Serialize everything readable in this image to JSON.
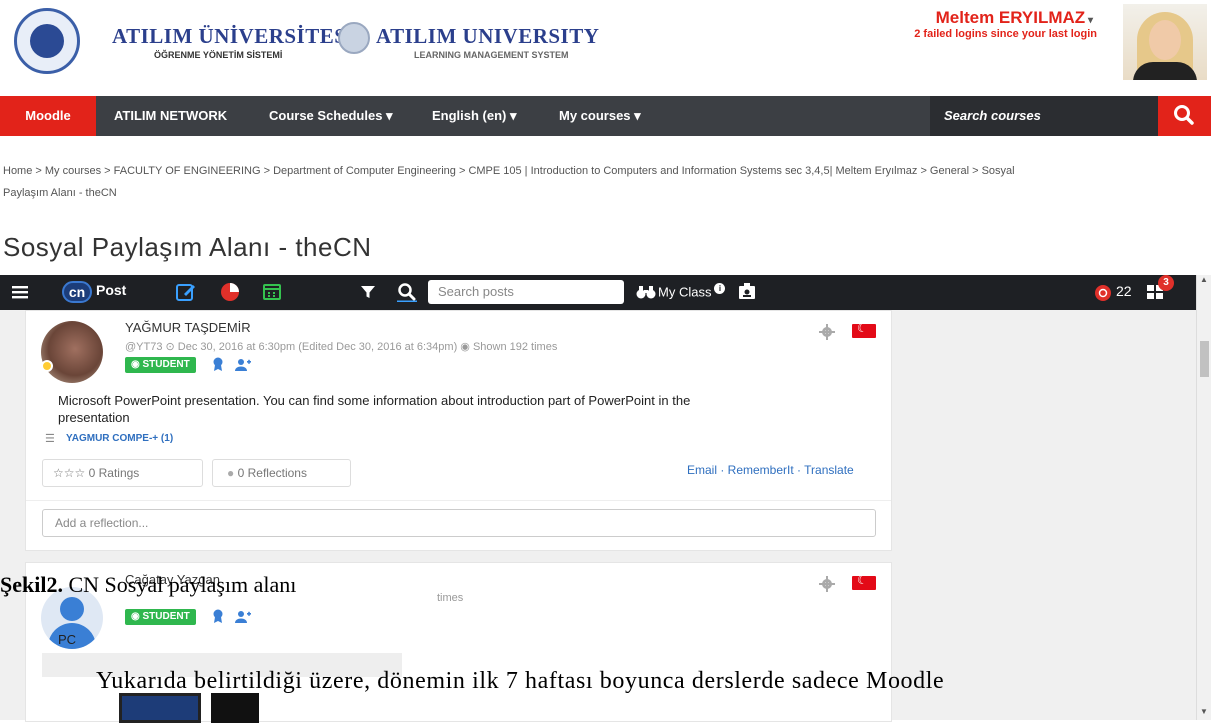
{
  "header": {
    "logo_tr_title": "ATILIM ÜNİVERSİTESİ",
    "logo_tr_subtitle": "ÖĞRENME YÖNETİM SİSTEMİ",
    "logo_en_title": "ATILIM UNIVERSITY",
    "logo_en_subtitle": "LEARNING MANAGEMENT SYSTEM",
    "user_name": "Meltem ERYILMAZ",
    "login_notice": "2 failed logins since your last login"
  },
  "nav": {
    "moodle": "Moodle",
    "network": "ATILIM NETWORK",
    "schedules": "Course Schedules ▾",
    "language": "English (en) ▾",
    "courses": "My courses ▾",
    "search_placeholder": "Search courses"
  },
  "breadcrumb": {
    "line1": "Home > My courses > FACULTY OF ENGINEERING > Department of Computer Engineering > CMPE 105 | Introduction to Computers and Information Systems sec 3,4,5| Meltem Eryılmaz > General > Sosyal",
    "line2": "Paylaşım Alanı - theCN"
  },
  "page_title": "Sosyal Paylaşım Alanı - theCN",
  "cn_toolbar": {
    "logo": "cn",
    "post_label": "Post",
    "search_placeholder": "Search posts",
    "my_class": "My Class",
    "my_class_badge": "i",
    "notif_count": "22",
    "grid_badge": "3"
  },
  "post1": {
    "author": "YAĞMUR TAŞDEMİR",
    "meta": "@YT73  ⊙ Dec 30, 2016 at 6:30pm (Edited Dec 30, 2016 at 6:34pm)  ◉ Shown 192 times",
    "role": "◉ STUDENT",
    "text_line1": "Microsoft PowerPoint presentation. You can find some information about introduction part of PowerPoint in the",
    "text_line2": "presentation",
    "attachment": "YAGMUR COMPE-+ (1)",
    "ratings": "☆☆☆ 0 Ratings",
    "reflections": "0 Reflections",
    "actions": "Email · RememberIt · Translate",
    "reflection_placeholder": "Add a reflection..."
  },
  "post2": {
    "author": "Çağatay Yazgan",
    "meta_tail": "times",
    "role": "◉ STUDENT",
    "text": "PC"
  },
  "document": {
    "caption_bold": "Şekil2.",
    "caption_text": " CN Sosyal paylaşım alanı",
    "paragraph": "Yukarıda belirtildiği üzere, dönemin ilk 7 haftası boyunca derslerde sadece Moodle"
  },
  "colors": {
    "brand_red": "#e2231a",
    "nav_dark": "#3c3f44",
    "student_green": "#2fb74e",
    "link_blue": "#2f6fbf"
  }
}
